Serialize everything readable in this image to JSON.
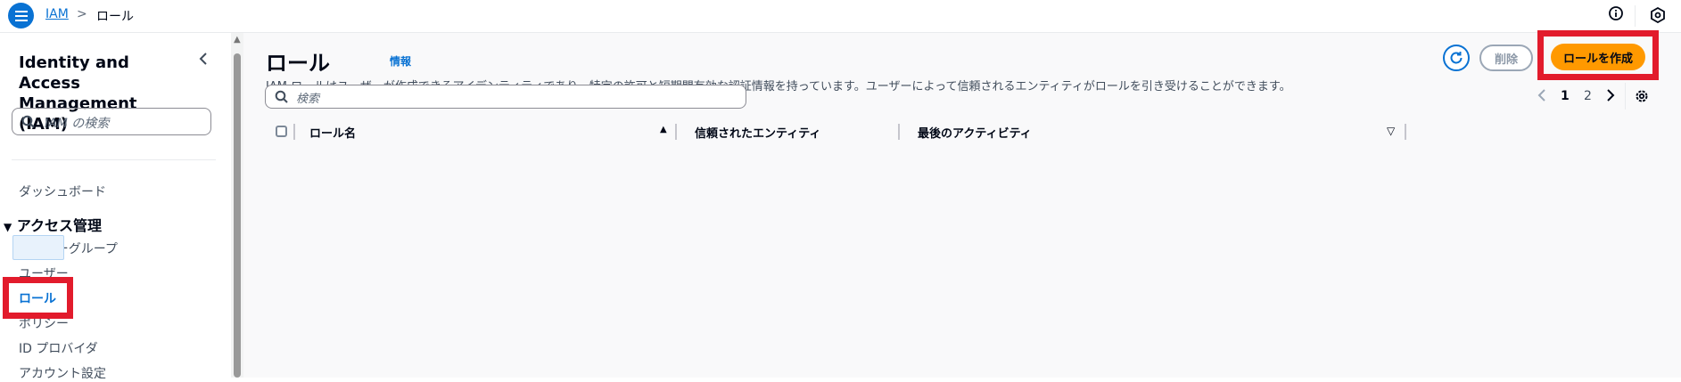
{
  "breadcrumb": {
    "service": "IAM",
    "separator": ">",
    "current": "ロール"
  },
  "topbar": {
    "info_icon": "info-icon",
    "settings_icon": "hexagon-icon"
  },
  "sidebar": {
    "title": "Identity and Access Management (IAM)",
    "search_placeholder": "IAM の検索",
    "dashboard": "ダッシュボード",
    "section_title": "アクセス管理",
    "section_caret": "▼",
    "items": [
      {
        "label": "ユーザーグループ"
      },
      {
        "label": "ユーザー"
      },
      {
        "label": "ロール"
      },
      {
        "label": "ポリシー"
      },
      {
        "label": "ID プロバイダ"
      },
      {
        "label": "アカウント設定"
      }
    ]
  },
  "main": {
    "title": "ロール",
    "info_link": "情報",
    "description": "IAM ロールはユーザーが作成できるアイデンティティであり、特定の許可と短期間有効な認証情報を持っています。ユーザーによって信頼されるエンティティがロールを引き受けることができます。",
    "delete_label": "削除",
    "create_label": "ロールを作成",
    "search_placeholder": "検索",
    "pagination": {
      "pages": [
        "1",
        "2"
      ],
      "current": "1"
    },
    "table": {
      "columns": [
        "ロール名",
        "信頼されたエンティティ",
        "最後のアクティビティ"
      ]
    }
  },
  "colors": {
    "accent": "#0972d3",
    "primary_button": "#ff9900",
    "highlight": "#e21b2c"
  }
}
